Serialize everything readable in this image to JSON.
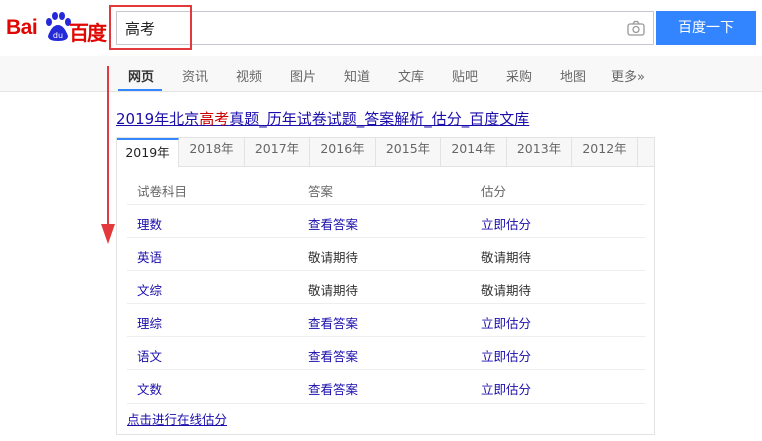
{
  "logo": {
    "part1": "Bai",
    "part2": "百度"
  },
  "search": {
    "query": "高考",
    "button_label": "百度一下"
  },
  "nav": {
    "items": [
      {
        "label": "网页",
        "active": true
      },
      {
        "label": "资讯"
      },
      {
        "label": "视频"
      },
      {
        "label": "图片"
      },
      {
        "label": "知道"
      },
      {
        "label": "文库"
      },
      {
        "label": "贴吧"
      },
      {
        "label": "采购"
      },
      {
        "label": "地图"
      },
      {
        "label": "更多»"
      }
    ]
  },
  "result": {
    "title_prefix": "2019年北京",
    "title_highlight": "高考",
    "title_suffix": "真题_历年试卷试题_答案解析_估分_百度文库",
    "year_tabs": [
      "2019年",
      "2018年",
      "2017年",
      "2016年",
      "2015年",
      "2014年",
      "2013年",
      "2012年"
    ],
    "active_year": "2019年",
    "columns": [
      "试卷科目",
      "答案",
      "估分"
    ],
    "rows": [
      {
        "subject": "理数",
        "answer": "查看答案",
        "score": "立即估分"
      },
      {
        "subject": "英语",
        "answer": "敬请期待",
        "score": "敬请期待"
      },
      {
        "subject": "文综",
        "answer": "敬请期待",
        "score": "敬请期待"
      },
      {
        "subject": "理综",
        "answer": "查看答案",
        "score": "立即估分"
      },
      {
        "subject": "语文",
        "answer": "查看答案",
        "score": "立即估分"
      },
      {
        "subject": "文数",
        "answer": "查看答案",
        "score": "立即估分"
      }
    ],
    "online_link": "点击进行在线估分"
  },
  "colors": {
    "brand_red": "#e10601",
    "brand_blue": "#2529d8",
    "button_blue": "#3385ff",
    "annotation_red": "#e4393c",
    "link": "#1a0dab"
  }
}
